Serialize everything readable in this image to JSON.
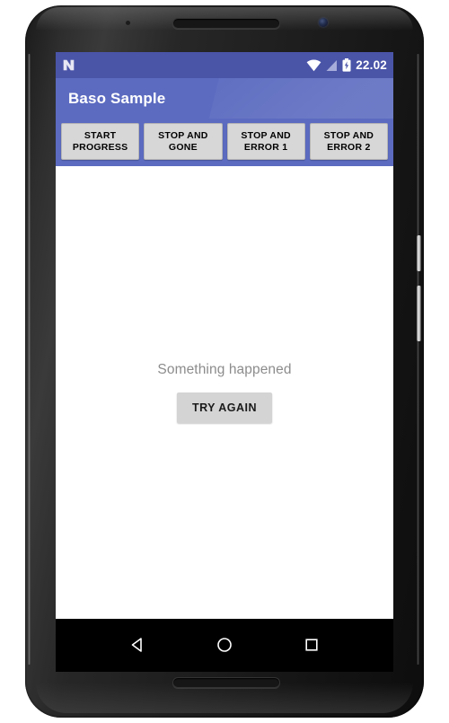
{
  "device": {
    "name": "android-phone",
    "hardware": {
      "top_speaker": "speaker-grille",
      "bottom_speaker": "speaker-grille",
      "front_camera": "camera-icon",
      "power_button": "power-button",
      "volume_button": "volume-button"
    }
  },
  "status_bar": {
    "os_logo": "android-n-logo",
    "icons": [
      "wifi-icon",
      "signal-icon",
      "battery-charging-icon"
    ],
    "time": "22.02",
    "background": "#4a55a8"
  },
  "app_bar": {
    "title": "Baso Sample",
    "background": "#5c6bc0",
    "text_color": "#ffffff"
  },
  "action_buttons": {
    "background": "#5c6bc0",
    "items": [
      {
        "id": "start-progress",
        "label": "START\nPROGRESS",
        "line1": "START",
        "line2": "PROGRESS"
      },
      {
        "id": "stop-and-gone",
        "label": "STOP AND\nGONE",
        "line1": "STOP AND",
        "line2": "GONE"
      },
      {
        "id": "stop-and-error-1",
        "label": "STOP AND\nERROR 1",
        "line1": "STOP AND",
        "line2": "ERROR 1"
      },
      {
        "id": "stop-and-error-2",
        "label": "STOP AND\nERROR 2",
        "line1": "STOP AND",
        "line2": "ERROR 2"
      }
    ]
  },
  "content": {
    "background": "#ffffff",
    "message": "Something happened",
    "message_color": "#8c8c8c",
    "retry_label": "TRY AGAIN",
    "retry_background": "#d4d4d4"
  },
  "nav_bar": {
    "background": "#000000",
    "items": [
      {
        "id": "back",
        "icon": "back-triangle-icon"
      },
      {
        "id": "home",
        "icon": "home-circle-icon"
      },
      {
        "id": "recents",
        "icon": "recents-square-icon"
      }
    ]
  }
}
